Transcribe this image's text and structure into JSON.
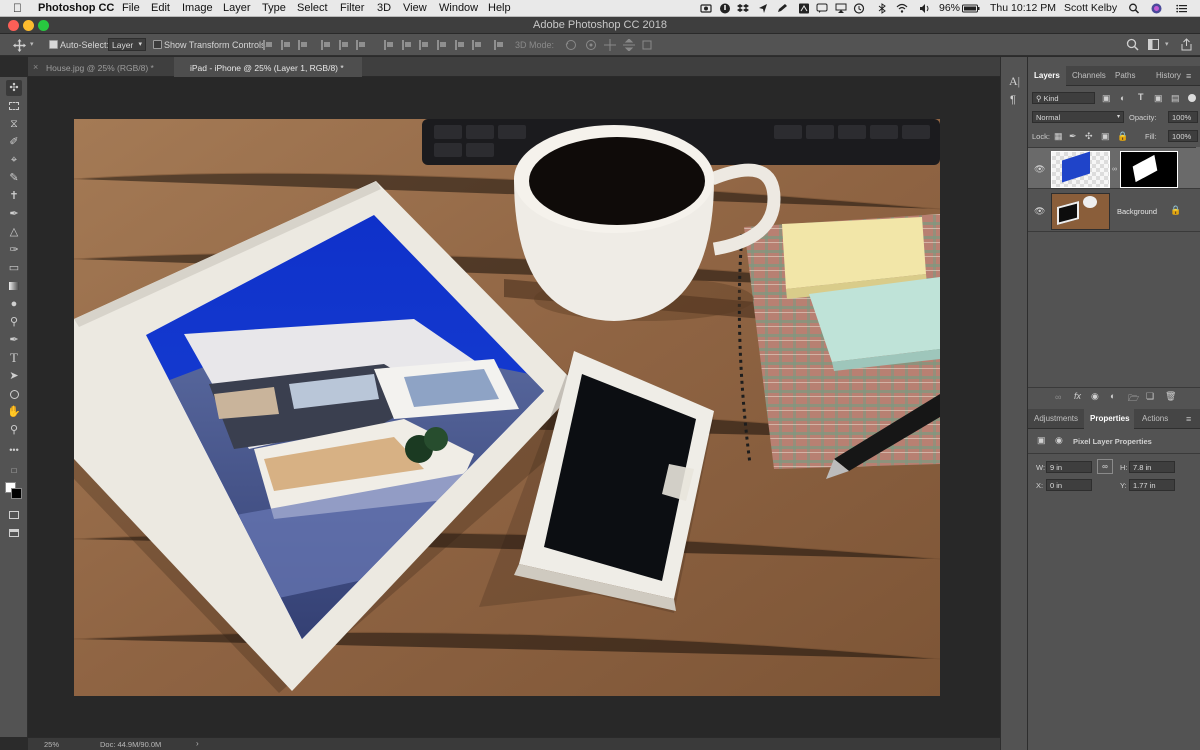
{
  "menubar": {
    "app_name": "Photoshop CC",
    "menus": [
      "File",
      "Edit",
      "Image",
      "Layer",
      "Type",
      "Select",
      "Filter",
      "3D",
      "View",
      "Window",
      "Help"
    ],
    "battery": "96%",
    "clock": "Thu 10:12 PM",
    "user": "Scott Kelby"
  },
  "window": {
    "title": "Adobe Photoshop CC 2018"
  },
  "options": {
    "auto_select_label": "Auto-Select:",
    "auto_select_value": "Layer",
    "show_transform_label": "Show Transform Controls",
    "mode_3d_label": "3D Mode:"
  },
  "tabs": [
    {
      "label": "House.jpg @ 25% (RGB/8) *"
    },
    {
      "label": "iPad - iPhone @ 25% (Layer 1, RGB/8) *"
    }
  ],
  "status": {
    "zoom": "25%",
    "doc": "Doc: 44.9M/90.0M"
  },
  "layers_panel": {
    "tabs": [
      "Layers",
      "Channels",
      "Paths",
      "History"
    ],
    "filter_value": "Kind",
    "blend_mode": "Normal",
    "opacity_label": "Opacity:",
    "opacity_value": "100%",
    "lock_label": "Lock:",
    "fill_label": "Fill:",
    "fill_value": "100%",
    "layers": [
      {
        "name": ""
      },
      {
        "name": "Background"
      }
    ]
  },
  "properties_panel": {
    "tabs": [
      "Adjustments",
      "Properties",
      "Actions"
    ],
    "heading": "Pixel Layer Properties",
    "w_label": "W:",
    "w_value": "9 in",
    "h_label": "H:",
    "h_value": "7.8 in",
    "x_label": "X:",
    "x_value": "0 in",
    "y_label": "Y:",
    "y_value": "1.77 in"
  },
  "colors": {
    "ui_dark": "#535353",
    "canvas_bg": "#282828",
    "selection_blue": "#1473e6"
  }
}
